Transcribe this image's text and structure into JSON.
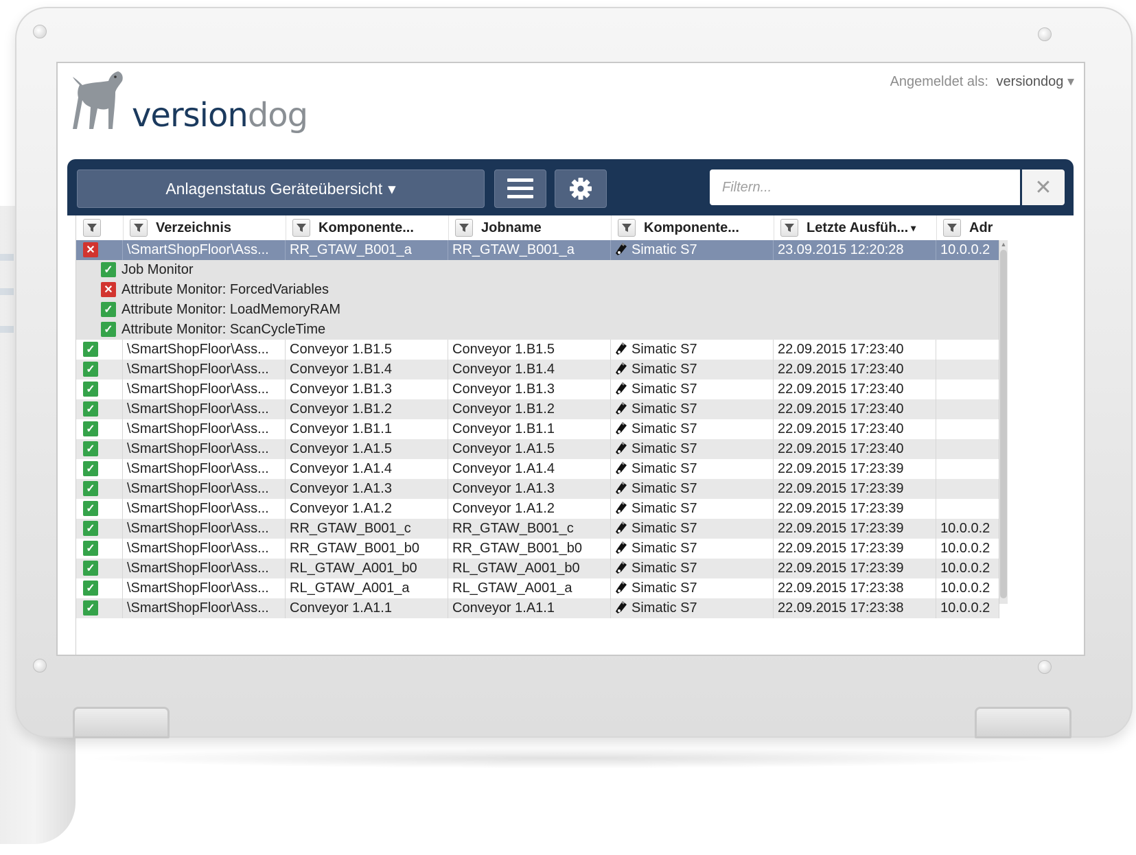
{
  "header": {
    "brand_part1": "version",
    "brand_part2": "dog",
    "login_label": "Angemeldet als:",
    "login_user": "versiondog",
    "login_caret": "▾"
  },
  "toolbar": {
    "view_label": "Anlagenstatus Geräteübersicht",
    "view_caret": "▾",
    "menu_icon": "hamburger-icon",
    "settings_icon": "gear-icon",
    "filter_placeholder": "Filtern...",
    "clear_label": "✕"
  },
  "columns": [
    {
      "label": ""
    },
    {
      "label": "Verzeichnis"
    },
    {
      "label": "Komponente..."
    },
    {
      "label": "Jobname"
    },
    {
      "label": "Komponente..."
    },
    {
      "label": "Letzte Ausfüh...",
      "sorted": "▾"
    },
    {
      "label": "Adr"
    }
  ],
  "colors": {
    "toolbar": "#1b3556",
    "selected_row": "#7e8fae",
    "ok": "#35a34a",
    "fail": "#d2342f"
  },
  "selected_row": {
    "status": "fail",
    "dir": "\\SmartShopFloor\\Ass...",
    "component": "RR_GTAW_B001_a",
    "job": "RR_GTAW_B001_a",
    "type": "Simatic S7",
    "last_run": "23.09.2015 12:20:28",
    "address": "10.0.0.2"
  },
  "monitors": [
    {
      "status": "ok",
      "label": "Job Monitor"
    },
    {
      "status": "fail",
      "label": "Attribute Monitor: ForcedVariables"
    },
    {
      "status": "ok",
      "label": "Attribute Monitor: LoadMemoryRAM"
    },
    {
      "status": "ok",
      "label": "Attribute Monitor: ScanCycleTime"
    }
  ],
  "rows": [
    {
      "status": "ok",
      "dir": "\\SmartShopFloor\\Ass...",
      "component": "Conveyor 1.B1.5",
      "job": "Conveyor 1.B1.5",
      "type": "Simatic S7",
      "last_run": "22.09.2015 17:23:40",
      "address": ""
    },
    {
      "status": "ok",
      "dir": "\\SmartShopFloor\\Ass...",
      "component": "Conveyor 1.B1.4",
      "job": "Conveyor 1.B1.4",
      "type": "Simatic S7",
      "last_run": "22.09.2015 17:23:40",
      "address": ""
    },
    {
      "status": "ok",
      "dir": "\\SmartShopFloor\\Ass...",
      "component": "Conveyor 1.B1.3",
      "job": "Conveyor 1.B1.3",
      "type": "Simatic S7",
      "last_run": "22.09.2015 17:23:40",
      "address": ""
    },
    {
      "status": "ok",
      "dir": "\\SmartShopFloor\\Ass...",
      "component": "Conveyor 1.B1.2",
      "job": "Conveyor 1.B1.2",
      "type": "Simatic S7",
      "last_run": "22.09.2015 17:23:40",
      "address": ""
    },
    {
      "status": "ok",
      "dir": "\\SmartShopFloor\\Ass...",
      "component": "Conveyor 1.B1.1",
      "job": "Conveyor 1.B1.1",
      "type": "Simatic S7",
      "last_run": "22.09.2015 17:23:40",
      "address": ""
    },
    {
      "status": "ok",
      "dir": "\\SmartShopFloor\\Ass...",
      "component": "Conveyor 1.A1.5",
      "job": "Conveyor 1.A1.5",
      "type": "Simatic S7",
      "last_run": "22.09.2015 17:23:40",
      "address": ""
    },
    {
      "status": "ok",
      "dir": "\\SmartShopFloor\\Ass...",
      "component": "Conveyor 1.A1.4",
      "job": "Conveyor 1.A1.4",
      "type": "Simatic S7",
      "last_run": "22.09.2015 17:23:39",
      "address": ""
    },
    {
      "status": "ok",
      "dir": "\\SmartShopFloor\\Ass...",
      "component": "Conveyor 1.A1.3",
      "job": "Conveyor 1.A1.3",
      "type": "Simatic S7",
      "last_run": "22.09.2015 17:23:39",
      "address": ""
    },
    {
      "status": "ok",
      "dir": "\\SmartShopFloor\\Ass...",
      "component": "Conveyor 1.A1.2",
      "job": "Conveyor 1.A1.2",
      "type": "Simatic S7",
      "last_run": "22.09.2015 17:23:39",
      "address": ""
    },
    {
      "status": "ok",
      "dir": "\\SmartShopFloor\\Ass...",
      "component": "RR_GTAW_B001_c",
      "job": "RR_GTAW_B001_c",
      "type": "Simatic S7",
      "last_run": "22.09.2015 17:23:39",
      "address": "10.0.0.2"
    },
    {
      "status": "ok",
      "dir": "\\SmartShopFloor\\Ass...",
      "component": "RR_GTAW_B001_b0",
      "job": "RR_GTAW_B001_b0",
      "type": "Simatic S7",
      "last_run": "22.09.2015 17:23:39",
      "address": "10.0.0.2"
    },
    {
      "status": "ok",
      "dir": "\\SmartShopFloor\\Ass...",
      "component": "RL_GTAW_A001_b0",
      "job": "RL_GTAW_A001_b0",
      "type": "Simatic S7",
      "last_run": "22.09.2015 17:23:39",
      "address": "10.0.0.2"
    },
    {
      "status": "ok",
      "dir": "\\SmartShopFloor\\Ass...",
      "component": "RL_GTAW_A001_a",
      "job": "RL_GTAW_A001_a",
      "type": "Simatic S7",
      "last_run": "22.09.2015 17:23:38",
      "address": "10.0.0.2"
    },
    {
      "status": "ok",
      "dir": "\\SmartShopFloor\\Ass...",
      "component": "Conveyor 1.A1.1",
      "job": "Conveyor 1.A1.1",
      "type": "Simatic S7",
      "last_run": "22.09.2015 17:23:38",
      "address": "10.0.0.2"
    }
  ]
}
